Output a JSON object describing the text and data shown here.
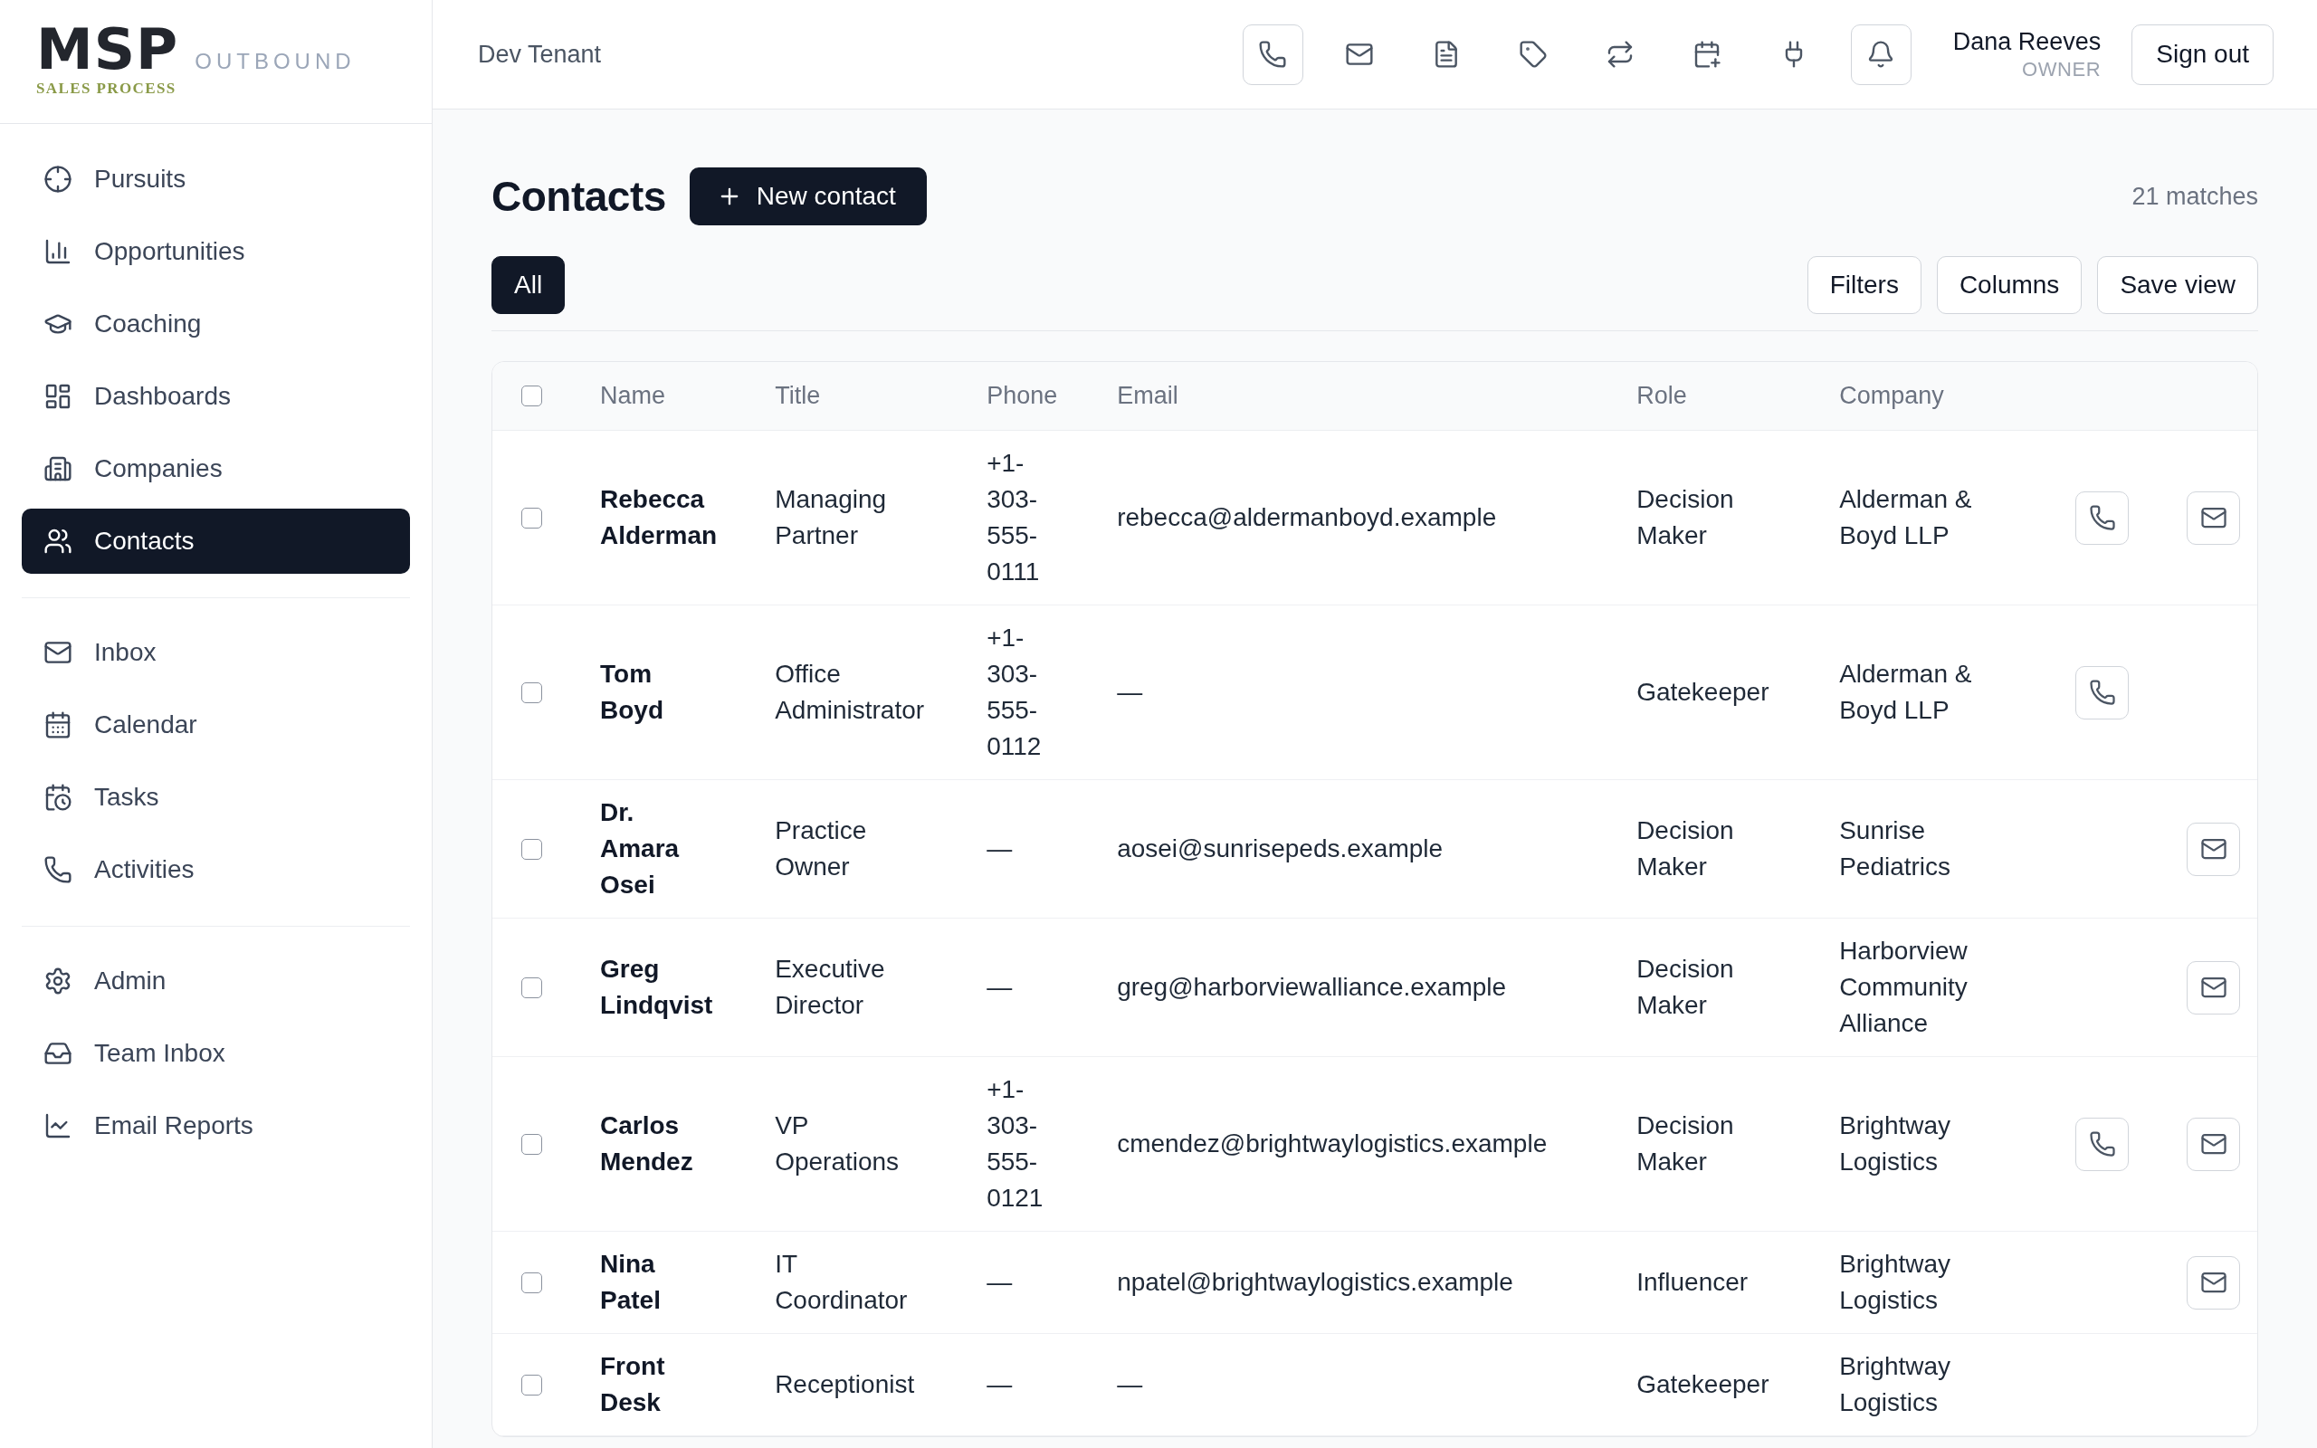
{
  "sidebar": {
    "logo": {
      "wordmark": "MSP",
      "tagline": "SALES PROCESS",
      "product": "OUTBOUND"
    },
    "nav_groups": [
      {
        "items": [
          {
            "label": "Pursuits",
            "selected": false
          },
          {
            "label": "Opportunities",
            "selected": false
          },
          {
            "label": "Coaching",
            "selected": false
          },
          {
            "label": "Dashboards",
            "selected": false
          },
          {
            "label": "Companies",
            "selected": false
          },
          {
            "label": "Contacts",
            "selected": true
          }
        ]
      },
      {
        "items": [
          {
            "label": "Inbox",
            "selected": false
          },
          {
            "label": "Calendar",
            "selected": false
          },
          {
            "label": "Tasks",
            "selected": false
          },
          {
            "label": "Activities",
            "selected": false
          }
        ]
      },
      {
        "items": [
          {
            "label": "Admin",
            "selected": false
          },
          {
            "label": "Team Inbox",
            "selected": false
          },
          {
            "label": "Email Reports",
            "selected": false
          }
        ]
      }
    ]
  },
  "topbar": {
    "tenant": "Dev Tenant",
    "tools": [
      {
        "kind": "boxed"
      },
      {
        "kind": "plain"
      },
      {
        "kind": "plain"
      },
      {
        "kind": "plain"
      },
      {
        "kind": "plain"
      },
      {
        "kind": "plain"
      },
      {
        "kind": "plain"
      },
      {
        "kind": "boxed"
      }
    ],
    "user": {
      "name": "Dana Reeves",
      "role": "OWNER"
    },
    "sign_out": "Sign out"
  },
  "page": {
    "title": "Contacts",
    "new_button": "New contact",
    "match_count": "21 matches",
    "views": [
      {
        "label": "All",
        "selected": true
      }
    ],
    "actions": [
      "Filters",
      "Columns",
      "Save view"
    ]
  },
  "table": {
    "select_all": {
      "checked": false
    },
    "columns": [
      "Name",
      "Title",
      "Phone",
      "Email",
      "Role",
      "Company"
    ],
    "rows": [
      {
        "checked": false,
        "name": "Rebecca Alderman",
        "title": "Managing Partner",
        "phone": "+1-303-555-0111",
        "email": "rebecca@aldermanboyd.example",
        "role": "Decision Maker",
        "company": "Alderman & Boyd LLP",
        "call_button": true,
        "email_button": true
      },
      {
        "checked": false,
        "name": "Tom Boyd",
        "title": "Office Administrator",
        "phone": "+1-303-555-0112",
        "email": "—",
        "role": "Gatekeeper",
        "company": "Alderman & Boyd LLP",
        "call_button": true,
        "email_button": false
      },
      {
        "checked": false,
        "name": "Dr. Amara Osei",
        "title": "Practice Owner",
        "phone": "—",
        "email": "aosei@sunrisepeds.example",
        "role": "Decision Maker",
        "company": "Sunrise Pediatrics",
        "call_button": false,
        "email_button": true
      },
      {
        "checked": false,
        "name": "Greg Lindqvist",
        "title": "Executive Director",
        "phone": "—",
        "email": "greg@harborviewalliance.example",
        "role": "Decision Maker",
        "company": "Harborview Community Alliance",
        "call_button": false,
        "email_button": true
      },
      {
        "checked": false,
        "name": "Carlos Mendez",
        "title": "VP Operations",
        "phone": "+1-303-555-0121",
        "email": "cmendez@brightwaylogistics.example",
        "role": "Decision Maker",
        "company": "Brightway Logistics",
        "call_button": true,
        "email_button": true
      },
      {
        "checked": false,
        "name": "Nina Patel",
        "title": "IT Coordinator",
        "phone": "—",
        "email": "npatel@brightwaylogistics.example",
        "role": "Influencer",
        "company": "Brightway Logistics",
        "call_button": false,
        "email_button": true
      },
      {
        "checked": false,
        "name": "Front Desk",
        "title": "Receptionist",
        "phone": "—",
        "email": "—",
        "role": "Gatekeeper",
        "company": "Brightway Logistics",
        "call_button": false,
        "email_button": false
      }
    ]
  }
}
